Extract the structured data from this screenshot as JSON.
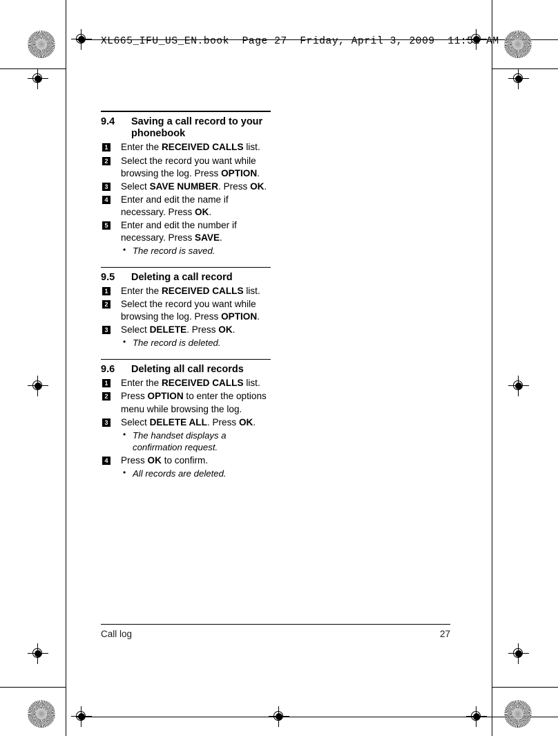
{
  "header": {
    "file_line": "XL665_IFU_US_EN.book  Page 27  Friday, April 3, 2009  11:51 AM"
  },
  "footer": {
    "chapter": "Call log",
    "page_number": "27"
  },
  "sections": [
    {
      "number": "9.4",
      "title": "Saving a call record to your phonebook",
      "steps": [
        {
          "n": "1",
          "html": "Enter the <b>RECEIVED CALLS</b> list."
        },
        {
          "n": "2",
          "html": "Select the record you want while browsing the log. Press <b>OPTION</b>."
        },
        {
          "n": "3",
          "html": "Select <b>SAVE NUMBER</b>. Press <b>OK</b>."
        },
        {
          "n": "4",
          "html": "Enter and edit the name if necessary. Press <b>OK</b>."
        },
        {
          "n": "5",
          "html": "Enter and edit the number if necessary. Press <b>SAVE</b>."
        }
      ],
      "notes": [
        "The record is saved."
      ]
    },
    {
      "number": "9.5",
      "title": "Deleting a call record",
      "steps": [
        {
          "n": "1",
          "html": "Enter the <b>RECEIVED CALLS</b> list."
        },
        {
          "n": "2",
          "html": "Select the record you want while browsing the log. Press <b>OPTION</b>."
        },
        {
          "n": "3",
          "html": "Select <b>DELETE</b>. Press <b>OK</b>."
        }
      ],
      "notes": [
        "The record is deleted."
      ]
    },
    {
      "number": "9.6",
      "title": "Deleting all call records",
      "steps": [
        {
          "n": "1",
          "html": "Enter the <b>RECEIVED CALLS</b> list."
        },
        {
          "n": "2",
          "html": "Press <b>OPTION</b> to enter the options menu while browsing the log."
        },
        {
          "n": "3",
          "html": "Select <b>DELETE ALL</b>. Press <b>OK</b>.",
          "notes_after": [
            "The handset displays a confirmation request."
          ]
        },
        {
          "n": "4",
          "html": "Press <b>OK</b> to confirm.",
          "notes_after": [
            "All records are deleted."
          ]
        }
      ],
      "notes": []
    }
  ]
}
